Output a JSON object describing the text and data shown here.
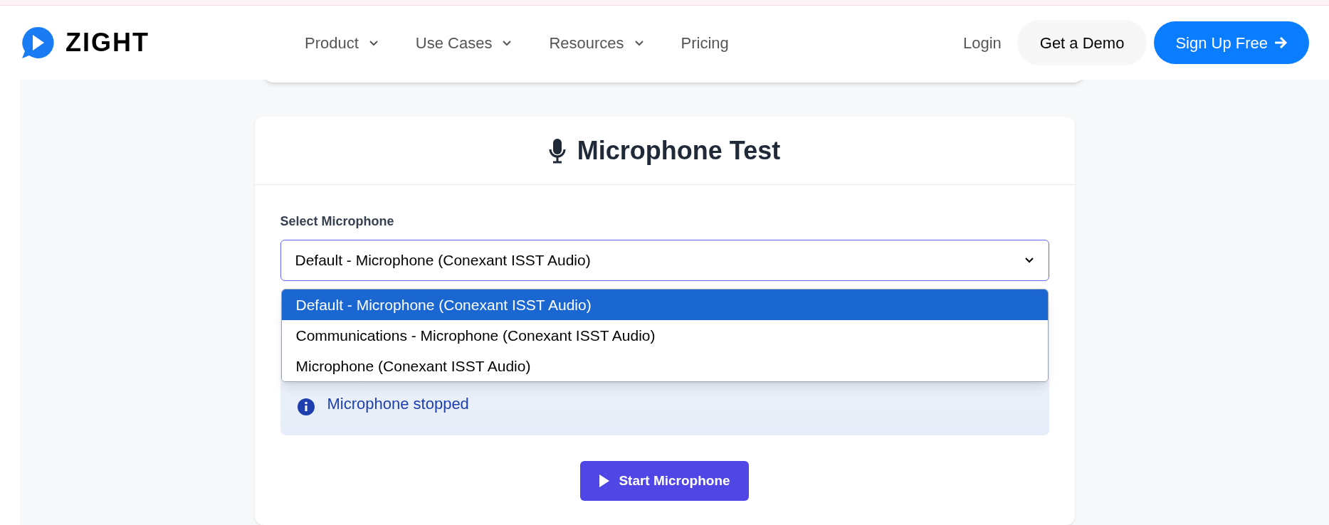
{
  "header": {
    "logo": "ZIGHT",
    "nav": [
      {
        "label": "Product",
        "dropdown": true
      },
      {
        "label": "Use Cases",
        "dropdown": true
      },
      {
        "label": "Resources",
        "dropdown": true
      },
      {
        "label": "Pricing",
        "dropdown": false
      }
    ],
    "login": "Login",
    "demo_button": "Get a Demo",
    "signup_button": "Sign Up Free"
  },
  "card": {
    "title": "Microphone Test",
    "select_label": "Select Microphone",
    "select_value": "Default - Microphone (Conexant ISST Audio)",
    "expanded": true,
    "options": [
      {
        "label": "Default - Microphone (Conexant ISST Audio)",
        "selected": true
      },
      {
        "label": "Communications - Microphone (Conexant ISST Audio)",
        "selected": false
      },
      {
        "label": "Microphone (Conexant ISST Audio)",
        "selected": false
      }
    ],
    "status": "Microphone stopped",
    "start_button": "Start Microphone"
  }
}
